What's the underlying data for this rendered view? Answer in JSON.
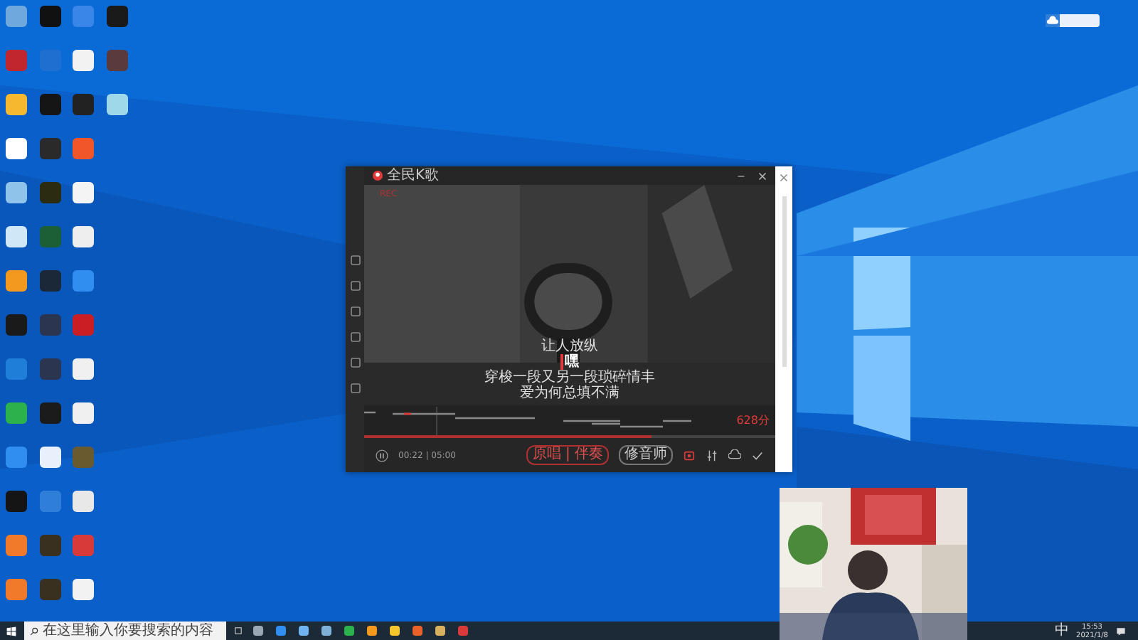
{
  "desktop_icons": [
    [
      {
        "color": "#6fa8dc"
      },
      {
        "color": "#111111"
      },
      {
        "color": "#3a86e8"
      },
      {
        "color": "#1a1a1a"
      }
    ],
    [
      {
        "color": "#c0262d"
      },
      {
        "color": "#1f6fd1"
      },
      {
        "color": "#f2f2f2"
      },
      {
        "color": "#5a3a3a"
      }
    ],
    [
      {
        "color": "#f5b82e"
      },
      {
        "color": "#151515"
      },
      {
        "color": "#222222"
      },
      {
        "color": "#9fd8e8"
      }
    ],
    [
      {
        "color": "#ffffff"
      },
      {
        "color": "#2a2a2a"
      },
      {
        "color": "#f0562a"
      }
    ],
    [
      {
        "color": "#8fc3ea"
      },
      {
        "color": "#2b2b10"
      },
      {
        "color": "#f4f4f4"
      }
    ],
    [
      {
        "color": "#cfe7f7"
      },
      {
        "color": "#1c5e35"
      },
      {
        "color": "#eeeeee"
      }
    ],
    [
      {
        "color": "#f39a1e"
      },
      {
        "color": "#1b2838"
      },
      {
        "color": "#2f8ef0"
      }
    ],
    [
      {
        "color": "#1a1a1a"
      },
      {
        "color": "#2b3550"
      },
      {
        "color": "#c81e24"
      }
    ],
    [
      {
        "color": "#1f7fd8"
      },
      {
        "color": "#2b3550"
      },
      {
        "color": "#f0f0f0"
      }
    ],
    [
      {
        "color": "#2bb24c"
      },
      {
        "color": "#1b1b1b"
      },
      {
        "color": "#f0f0f0"
      }
    ],
    [
      {
        "color": "#2f8ef0"
      },
      {
        "color": "#e8f1fb"
      },
      {
        "color": "#6a5a30"
      }
    ],
    [
      {
        "color": "#151515"
      },
      {
        "color": "#2f7fd8"
      },
      {
        "color": "#e8e8e8"
      }
    ],
    [
      {
        "color": "#f07a2a"
      },
      {
        "color": "#3a3020"
      },
      {
        "color": "#d83a3a"
      }
    ],
    [
      {
        "color": "#f07a2a"
      },
      {
        "color": "#3a3020"
      },
      {
        "color": "#f2f2f2"
      }
    ]
  ],
  "player": {
    "title": "全民K歌",
    "rec": "REC",
    "lyrics": [
      {
        "text": "让人放纵",
        "selected": false
      },
      {
        "text": "嘿",
        "selected": true
      },
      {
        "text": "穿梭一段又另一段琐碎情丰",
        "selected": false
      },
      {
        "text": "爱为何总填不满",
        "selected": false
      }
    ],
    "score": "628分",
    "level": 0.7,
    "time": "00:22 | 05:00",
    "vocal_toggle": "原唱 | 伴奏",
    "tune_button": "修音师"
  },
  "taskbar": {
    "search": {
      "placeholder": "在这里输入你要搜索的内容"
    },
    "apps": [
      {
        "color": "#9aa7b4"
      },
      {
        "color": "#2f8ef0"
      },
      {
        "color": "#6fb3f0"
      },
      {
        "color": "#7fb0d8"
      },
      {
        "color": "#2bb24c"
      },
      {
        "color": "#f39a1e"
      },
      {
        "color": "#f5c52e"
      },
      {
        "color": "#e8622a"
      },
      {
        "color": "#d8b060"
      },
      {
        "color": "#d83a3a"
      }
    ],
    "ime": "中",
    "clock": "15:53",
    "date": "2021/1/8"
  }
}
